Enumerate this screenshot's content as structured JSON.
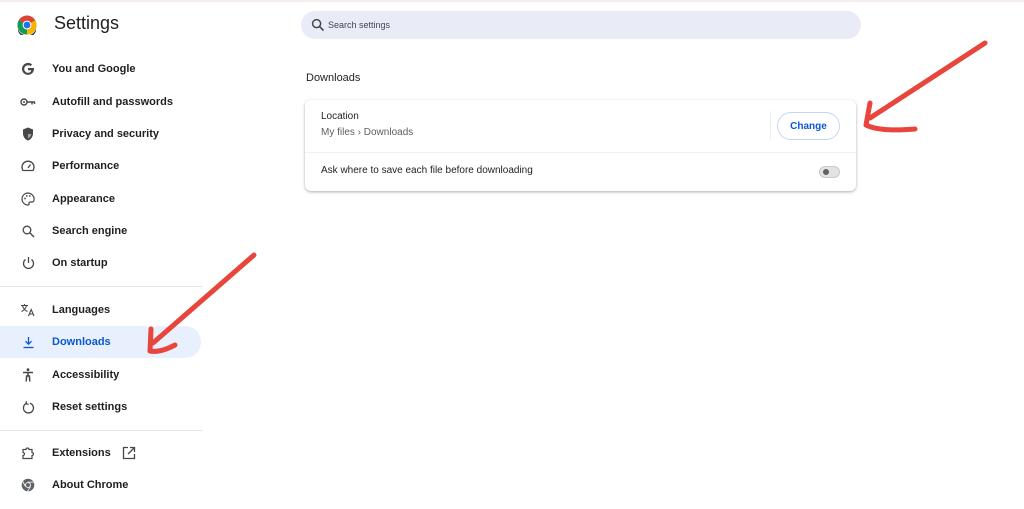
{
  "app": {
    "title": "Settings",
    "logo_icon": "chrome-logo-icon"
  },
  "sidebar": {
    "items": [
      {
        "label": "You and Google",
        "icon": "google-g-icon",
        "active": false
      },
      {
        "label": "Autofill and passwords",
        "icon": "key-icon",
        "active": false
      },
      {
        "label": "Privacy and security",
        "icon": "shield-icon",
        "active": false
      },
      {
        "label": "Performance",
        "icon": "speedometer-icon",
        "active": false
      },
      {
        "label": "Appearance",
        "icon": "palette-icon",
        "active": false
      },
      {
        "label": "Search engine",
        "icon": "search-icon",
        "active": false
      },
      {
        "label": "On startup",
        "icon": "power-icon",
        "active": false
      },
      {
        "label": "Languages",
        "icon": "translate-icon",
        "active": false
      },
      {
        "label": "Downloads",
        "icon": "download-icon",
        "active": true
      },
      {
        "label": "Accessibility",
        "icon": "accessibility-icon",
        "active": false
      },
      {
        "label": "Reset settings",
        "icon": "reset-icon",
        "active": false
      },
      {
        "label": "Extensions",
        "icon": "puzzle-icon",
        "active": false,
        "external_icon": "open-in-new-icon"
      },
      {
        "label": "About Chrome",
        "icon": "chrome-icon",
        "active": false
      }
    ]
  },
  "search": {
    "placeholder": "Search settings",
    "value": ""
  },
  "main": {
    "section_title": "Downloads",
    "location": {
      "label": "Location",
      "path": "My files › Downloads",
      "button_label": "Change"
    },
    "ask_where": {
      "label": "Ask where to save each file before downloading",
      "enabled": false
    }
  },
  "colors": {
    "accent": "#0b57d0",
    "active_bg": "#e8effd",
    "search_bg": "#e9ecf6",
    "annotation_arrow": "#e8453c"
  }
}
